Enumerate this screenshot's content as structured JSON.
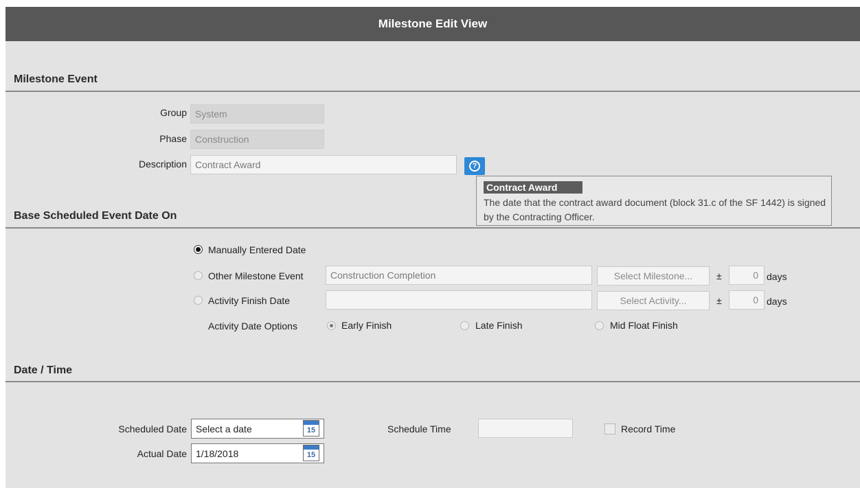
{
  "window": {
    "title": "Milestone Edit View"
  },
  "sections": {
    "milestone_event": "Milestone Event",
    "base_scheduled": "Base Scheduled Event Date On",
    "date_time": "Date / Time"
  },
  "milestone": {
    "group_label": "Group",
    "group_value": "System",
    "phase_label": "Phase",
    "phase_value": "Construction",
    "description_label": "Description",
    "description_value": "Contract Award",
    "help_icon": "question-circle-icon"
  },
  "tooltip": {
    "title": "Contract Award",
    "body": "The date that the contract award document (block 31.c of the SF 1442) is signed by the Contracting Officer."
  },
  "base": {
    "manual_label": "Manually Entered Date",
    "manual_selected": true,
    "other_label": "Other Milestone Event",
    "other_value": "Construction Completion",
    "select_milestone": "Select Milestone...",
    "plusminus": "±",
    "other_days": "0",
    "days_label": "days",
    "activity_label": "Activity Finish Date",
    "activity_value": "",
    "select_activity": "Select Activity...",
    "activity_days": "0",
    "options_label": "Activity Date Options",
    "early_finish": "Early Finish",
    "late_finish": "Late Finish",
    "mid_float_finish": "Mid Float Finish"
  },
  "datetime": {
    "scheduled_label": "Scheduled Date",
    "scheduled_placeholder": "Select a date",
    "actual_label": "Actual Date",
    "actual_value": "1/18/2018",
    "calendar_day": "15",
    "calendar_icon": "calendar-icon",
    "schedule_time_label": "Schedule Time",
    "schedule_time_value": "",
    "record_time_label": "Record Time"
  }
}
